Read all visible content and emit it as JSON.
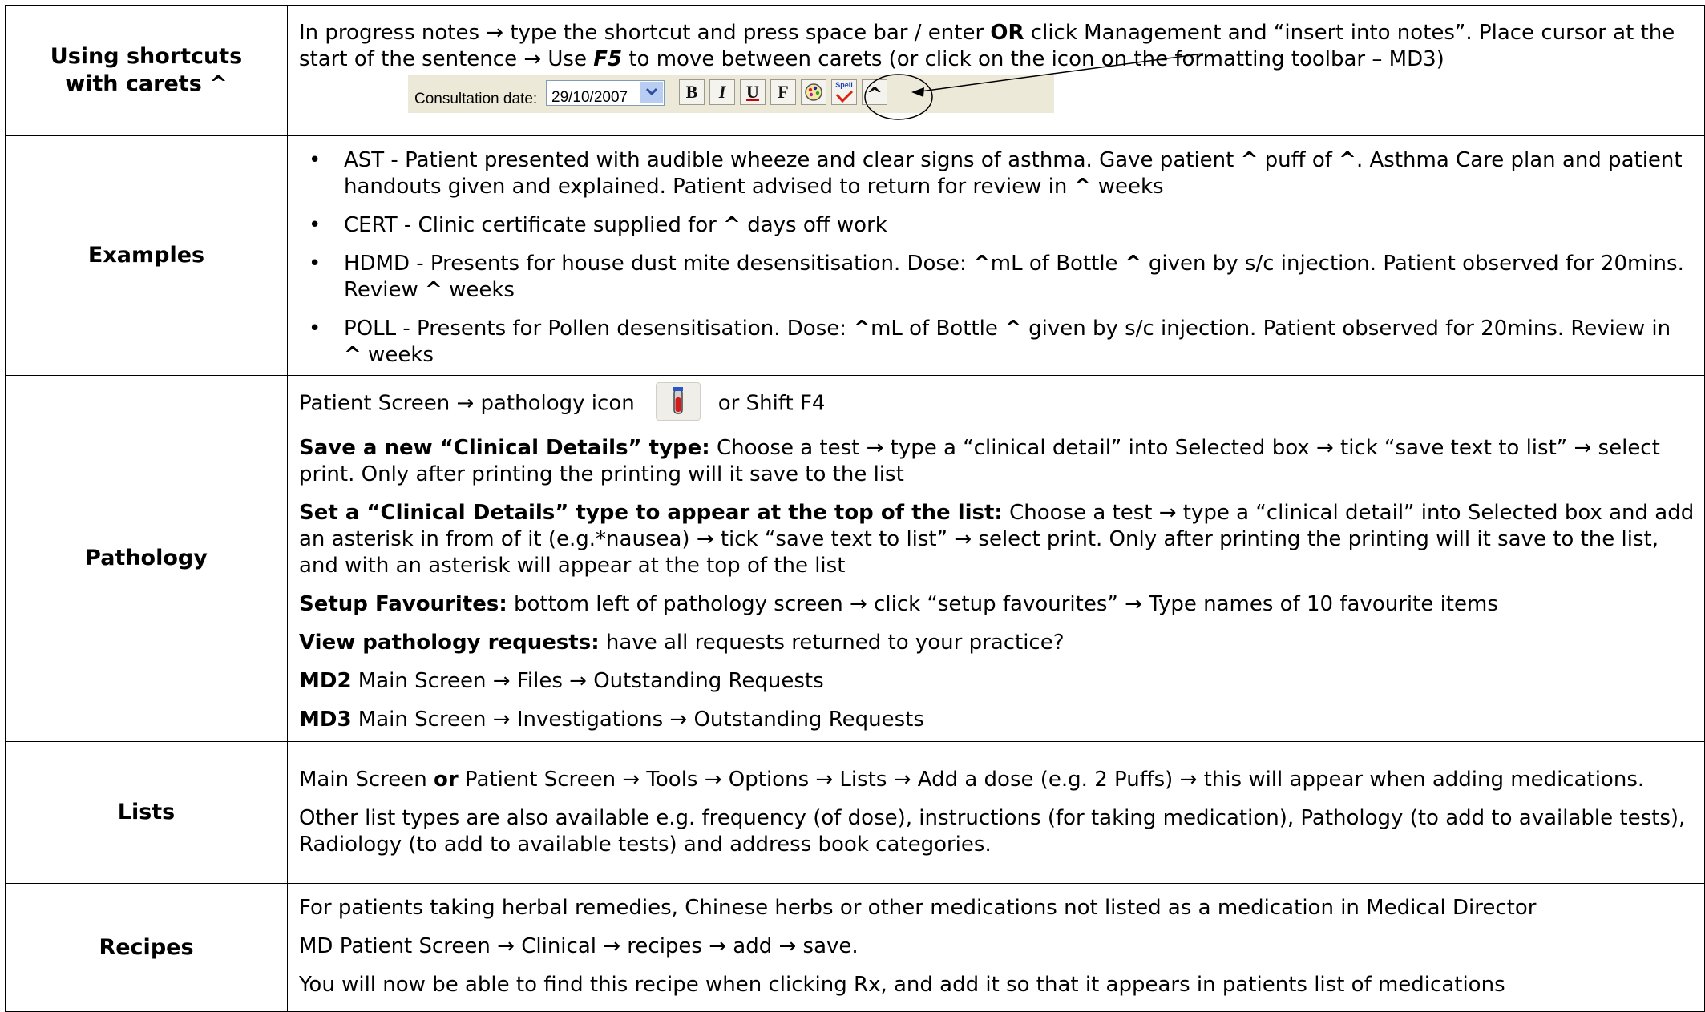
{
  "rows": {
    "carets": {
      "label_line1": "Using shortcuts",
      "label_line2": "with carets ^",
      "text_1": "In progress notes → type the shortcut and press space bar / enter ",
      "text_or": "OR",
      "text_2": " click Management and “insert into notes”. Place cursor at the start of the sentence → Use ",
      "text_f5": "F5",
      "text_3": " to move between carets (or click on the icon on the formatting toolbar – MD3)",
      "toolbar": {
        "label": "Consultation date:",
        "date_value": "29/10/2007",
        "buttons": [
          "B",
          "I",
          "U",
          "F"
        ],
        "spell_label": "Spell",
        "caret_button": "^"
      }
    },
    "examples": {
      "label": "Examples",
      "bullet": "•",
      "items": [
        {
          "a": "AST - Patient presented with audible wheeze and clear signs of asthma. Gave patient ",
          "c1": "^",
          "b": " puff of ",
          "c2": "^",
          "c": ". Asthma Care plan and patient handouts given and explained. Patient advised to return for review in ",
          "c3": "^",
          "d": " weeks"
        },
        {
          "a": "CERT - Clinic certificate supplied for ",
          "c1": "^",
          "b": " days off work"
        },
        {
          "a": "HDMD - Presents for house dust mite desensitisation. Dose: ",
          "c1": "^",
          "b": "mL of Bottle ",
          "c2": "^",
          "c": " given by s/c injection.  Patient observed for 20mins.  Review ",
          "c3": "^",
          "d": " weeks"
        },
        {
          "a": "POLL - Presents for Pollen desensitisation. Dose: ",
          "c1": "^",
          "b": "mL of Bottle ",
          "c2": "^",
          "c": " given by s/c injection.  Patient observed for 20mins. Review in ",
          "c3": "^",
          "d": " weeks"
        }
      ]
    },
    "pathology": {
      "label": "Pathology",
      "line1_a": "Patient Screen → pathology icon",
      "line1_b": "or Shift F4",
      "p2_bold": "Save a new “Clinical Details” type:",
      "p2_text": " Choose a test → type a “clinical detail” into Selected box → tick “save text to list” → select print. Only after printing the printing will it save to the list",
      "p3_bold": "Set a “Clinical Details” type to appear at the top of the list:",
      "p3_text": " Choose a test → type a “clinical detail” into Selected box and add an asterisk in from of it (e.g.*nausea) → tick “save text to list” → select print. Only after printing the printing will it save to the list, and with an asterisk will appear at the top of the list",
      "p4_bold": "Setup Favourites:",
      "p4_text": " bottom left of pathology screen → click “setup favourites” → Type names of 10 favourite items",
      "p5_bold": "View pathology requests:",
      "p5_text": " have all requests returned to your practice?",
      "p6_bold": "MD2",
      "p6_text": " Main Screen → Files → Outstanding Requests",
      "p7_bold": "MD3",
      "p7_text": " Main Screen → Investigations → Outstanding Requests"
    },
    "lists": {
      "label": "Lists",
      "p1_a": "Main Screen ",
      "p1_or": "or",
      "p1_b": " Patient Screen → Tools → Options → Lists → Add a dose (e.g. 2 Puffs) → this will appear when adding medications.",
      "p2": "Other list types are also available e.g. frequency (of dose), instructions (for taking medication), Pathology (to add to available tests), Radiology (to add to available tests) and address book categories."
    },
    "recipes": {
      "label": "Recipes",
      "p1": "For patients taking herbal remedies, Chinese herbs or other medications not listed as a medication in Medical Director",
      "p2": "MD Patient Screen → Clinical → recipes → add → save.",
      "p3": "You will now be able to find this recipe when clicking Rx, and add it so that it appears in patients list of medications"
    }
  }
}
